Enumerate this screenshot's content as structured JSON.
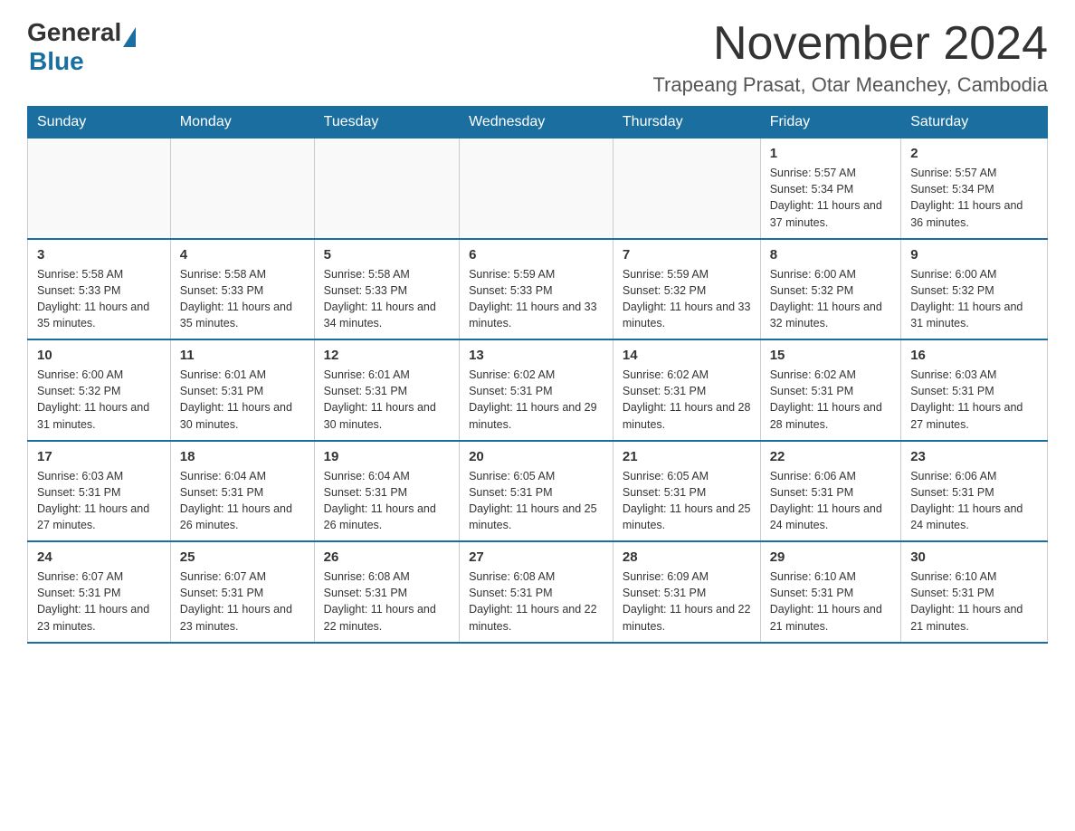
{
  "logo": {
    "general": "General",
    "blue": "Blue"
  },
  "title": "November 2024",
  "subtitle": "Trapeang Prasat, Otar Meanchey, Cambodia",
  "days_of_week": [
    "Sunday",
    "Monday",
    "Tuesday",
    "Wednesday",
    "Thursday",
    "Friday",
    "Saturday"
  ],
  "weeks": [
    [
      {
        "day": "",
        "info": ""
      },
      {
        "day": "",
        "info": ""
      },
      {
        "day": "",
        "info": ""
      },
      {
        "day": "",
        "info": ""
      },
      {
        "day": "",
        "info": ""
      },
      {
        "day": "1",
        "info": "Sunrise: 5:57 AM\nSunset: 5:34 PM\nDaylight: 11 hours and 37 minutes."
      },
      {
        "day": "2",
        "info": "Sunrise: 5:57 AM\nSunset: 5:34 PM\nDaylight: 11 hours and 36 minutes."
      }
    ],
    [
      {
        "day": "3",
        "info": "Sunrise: 5:58 AM\nSunset: 5:33 PM\nDaylight: 11 hours and 35 minutes."
      },
      {
        "day": "4",
        "info": "Sunrise: 5:58 AM\nSunset: 5:33 PM\nDaylight: 11 hours and 35 minutes."
      },
      {
        "day": "5",
        "info": "Sunrise: 5:58 AM\nSunset: 5:33 PM\nDaylight: 11 hours and 34 minutes."
      },
      {
        "day": "6",
        "info": "Sunrise: 5:59 AM\nSunset: 5:33 PM\nDaylight: 11 hours and 33 minutes."
      },
      {
        "day": "7",
        "info": "Sunrise: 5:59 AM\nSunset: 5:32 PM\nDaylight: 11 hours and 33 minutes."
      },
      {
        "day": "8",
        "info": "Sunrise: 6:00 AM\nSunset: 5:32 PM\nDaylight: 11 hours and 32 minutes."
      },
      {
        "day": "9",
        "info": "Sunrise: 6:00 AM\nSunset: 5:32 PM\nDaylight: 11 hours and 31 minutes."
      }
    ],
    [
      {
        "day": "10",
        "info": "Sunrise: 6:00 AM\nSunset: 5:32 PM\nDaylight: 11 hours and 31 minutes."
      },
      {
        "day": "11",
        "info": "Sunrise: 6:01 AM\nSunset: 5:31 PM\nDaylight: 11 hours and 30 minutes."
      },
      {
        "day": "12",
        "info": "Sunrise: 6:01 AM\nSunset: 5:31 PM\nDaylight: 11 hours and 30 minutes."
      },
      {
        "day": "13",
        "info": "Sunrise: 6:02 AM\nSunset: 5:31 PM\nDaylight: 11 hours and 29 minutes."
      },
      {
        "day": "14",
        "info": "Sunrise: 6:02 AM\nSunset: 5:31 PM\nDaylight: 11 hours and 28 minutes."
      },
      {
        "day": "15",
        "info": "Sunrise: 6:02 AM\nSunset: 5:31 PM\nDaylight: 11 hours and 28 minutes."
      },
      {
        "day": "16",
        "info": "Sunrise: 6:03 AM\nSunset: 5:31 PM\nDaylight: 11 hours and 27 minutes."
      }
    ],
    [
      {
        "day": "17",
        "info": "Sunrise: 6:03 AM\nSunset: 5:31 PM\nDaylight: 11 hours and 27 minutes."
      },
      {
        "day": "18",
        "info": "Sunrise: 6:04 AM\nSunset: 5:31 PM\nDaylight: 11 hours and 26 minutes."
      },
      {
        "day": "19",
        "info": "Sunrise: 6:04 AM\nSunset: 5:31 PM\nDaylight: 11 hours and 26 minutes."
      },
      {
        "day": "20",
        "info": "Sunrise: 6:05 AM\nSunset: 5:31 PM\nDaylight: 11 hours and 25 minutes."
      },
      {
        "day": "21",
        "info": "Sunrise: 6:05 AM\nSunset: 5:31 PM\nDaylight: 11 hours and 25 minutes."
      },
      {
        "day": "22",
        "info": "Sunrise: 6:06 AM\nSunset: 5:31 PM\nDaylight: 11 hours and 24 minutes."
      },
      {
        "day": "23",
        "info": "Sunrise: 6:06 AM\nSunset: 5:31 PM\nDaylight: 11 hours and 24 minutes."
      }
    ],
    [
      {
        "day": "24",
        "info": "Sunrise: 6:07 AM\nSunset: 5:31 PM\nDaylight: 11 hours and 23 minutes."
      },
      {
        "day": "25",
        "info": "Sunrise: 6:07 AM\nSunset: 5:31 PM\nDaylight: 11 hours and 23 minutes."
      },
      {
        "day": "26",
        "info": "Sunrise: 6:08 AM\nSunset: 5:31 PM\nDaylight: 11 hours and 22 minutes."
      },
      {
        "day": "27",
        "info": "Sunrise: 6:08 AM\nSunset: 5:31 PM\nDaylight: 11 hours and 22 minutes."
      },
      {
        "day": "28",
        "info": "Sunrise: 6:09 AM\nSunset: 5:31 PM\nDaylight: 11 hours and 22 minutes."
      },
      {
        "day": "29",
        "info": "Sunrise: 6:10 AM\nSunset: 5:31 PM\nDaylight: 11 hours and 21 minutes."
      },
      {
        "day": "30",
        "info": "Sunrise: 6:10 AM\nSunset: 5:31 PM\nDaylight: 11 hours and 21 minutes."
      }
    ]
  ]
}
